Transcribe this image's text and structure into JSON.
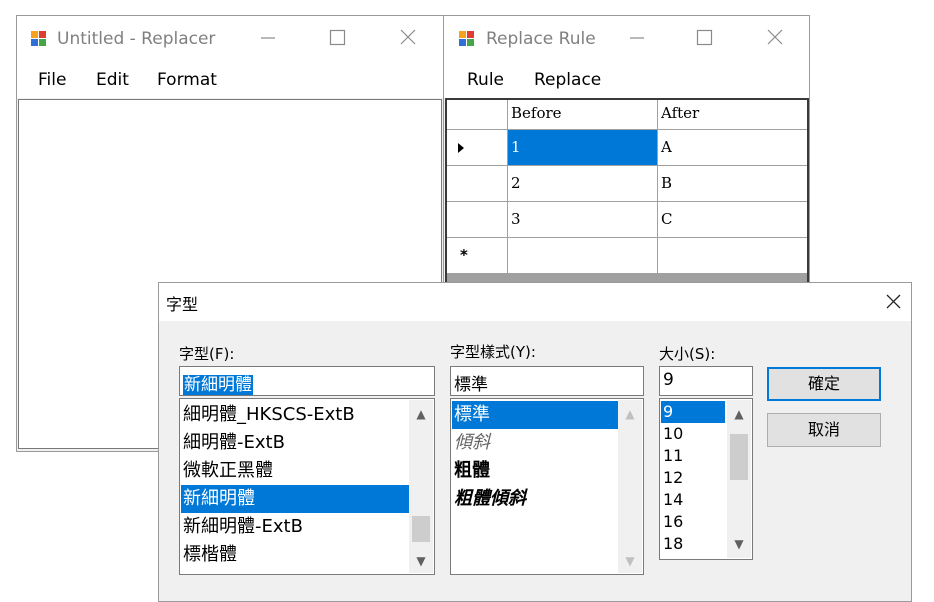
{
  "replacer_window": {
    "title": "Untitled - Replacer",
    "menu": [
      "File",
      "Edit",
      "Format"
    ]
  },
  "rule_window": {
    "title": "Replace Rule",
    "menu": [
      "Rule",
      "Replace"
    ],
    "columns": [
      "Before",
      "After"
    ],
    "rows": [
      {
        "before": "1",
        "after": "A"
      },
      {
        "before": "2",
        "after": "B"
      },
      {
        "before": "3",
        "after": "C"
      }
    ],
    "new_row_marker": "*"
  },
  "font_dialog": {
    "title": "字型",
    "font_label": "字型(F):",
    "font_value": "新細明體",
    "font_list": [
      "細明體_HKSCS-ExtB",
      "細明體-ExtB",
      "微軟正黑體",
      "新細明體",
      "新細明體-ExtB",
      "標楷體"
    ],
    "font_selected_index": 3,
    "style_label": "字型樣式(Y):",
    "style_value": "標準",
    "style_list": [
      "標準",
      "傾斜",
      "粗體",
      "粗體傾斜"
    ],
    "style_selected_index": 0,
    "size_label": "大小(S):",
    "size_value": "9",
    "size_list": [
      "9",
      "10",
      "11",
      "12",
      "14",
      "16",
      "18"
    ],
    "size_selected_index": 0,
    "ok_label": "確定",
    "cancel_label": "取消"
  },
  "colors": {
    "selection": "#0078d7",
    "window_bg": "#f0f0f0",
    "grid_border": "#3a3a3a"
  }
}
